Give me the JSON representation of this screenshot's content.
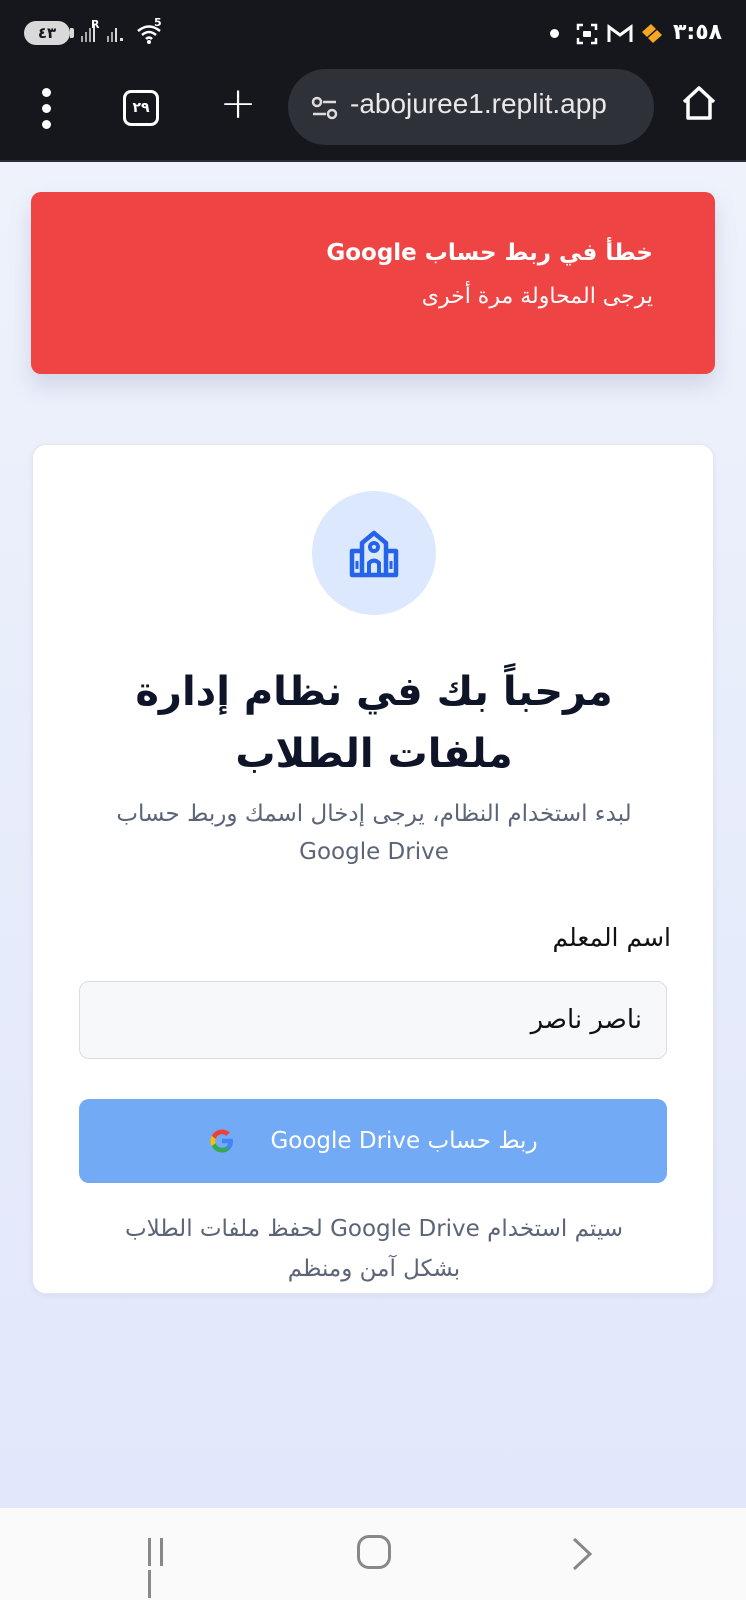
{
  "status_bar": {
    "battery": "٤٣",
    "time": "٣:٥٨",
    "wifi_badge": "5",
    "signal_badge": "R"
  },
  "browser": {
    "tab_count": "٢٩",
    "url": "-abojuree1.replit.app",
    "new_tab_symbol": "+"
  },
  "error_toast": {
    "title": "خطأ في ربط حساب Google",
    "message": "يرجى المحاولة مرة أخرى"
  },
  "card": {
    "logo_icon": "school-icon",
    "title": "مرحباً بك في نظام إدارة ملفات الطلاب",
    "subtitle": "لبدء استخدام النظام، يرجى إدخال اسمك وربط حساب Google Drive",
    "name_label": "اسم المعلم",
    "name_value": "ناصر ناصر",
    "connect_button_label": "ربط حساب Google Drive",
    "footer_note": "سيتم استخدام Google Drive لحفظ ملفات الطلاب بشكل آمن ومنظم"
  },
  "colors": {
    "error": "#ef4444",
    "button": "#72aaf6",
    "logo_bg": "#dbe8fd",
    "logo_fg": "#2563eb",
    "chrome": "#15171c"
  }
}
